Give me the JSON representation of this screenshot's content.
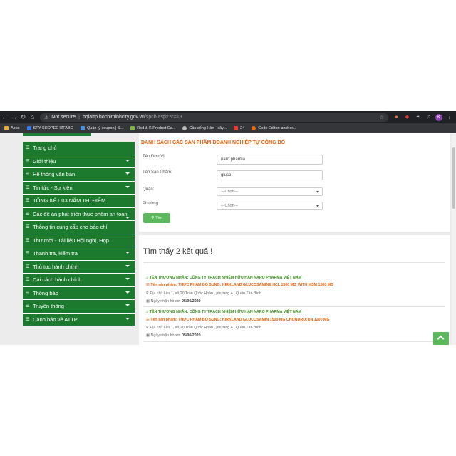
{
  "browser": {
    "security_label": "Not secure",
    "url_host": "bqlattp.hochiminhcity.gov.vn",
    "url_path": "/spcb.aspx?c=19",
    "profile_initial": "K",
    "bookmarks": [
      {
        "label": "Apps",
        "color": "#e0b030"
      },
      {
        "label": "SPY SHOPEE IZFABO",
        "color": "#3b78e7"
      },
      {
        "label": "Quản lý coupon | S...",
        "color": "#4a90d9"
      },
      {
        "label": "Red & K Product Ca...",
        "color": "#7cb342"
      },
      {
        "label": "Cầu sống Hàn - cây...",
        "color": "#bbbbbb"
      },
      {
        "label": "24",
        "color": "#e53935"
      },
      {
        "label": "Code Editor: anchor...",
        "color": "#ef6c00"
      }
    ]
  },
  "sidebar": {
    "items": [
      {
        "label": "Trang chủ",
        "dropdown": false
      },
      {
        "label": "Giới thiệu",
        "dropdown": true
      },
      {
        "label": "Hệ thống văn bản",
        "dropdown": true
      },
      {
        "label": "Tin tức - Sự kiện",
        "dropdown": true
      },
      {
        "label": "TỔNG KẾT 03 NĂM THÍ ĐIỂM",
        "dropdown": false
      },
      {
        "label": "Các đề án phát triển thực phẩm an toàn",
        "dropdown": true
      },
      {
        "label": "Thông tin cung cấp cho báo chí",
        "dropdown": false
      },
      {
        "label": "Thư mời - Tài liệu Hội nghị, Họp",
        "dropdown": false
      },
      {
        "label": "Thanh tra, kiểm tra",
        "dropdown": true
      },
      {
        "label": "Thủ tục hành chính",
        "dropdown": true
      },
      {
        "label": "Cải cách hành chính",
        "dropdown": true
      },
      {
        "label": "Thông báo",
        "dropdown": true
      },
      {
        "label": "Truyền thông",
        "dropdown": true
      },
      {
        "label": "Cảnh báo về ATTP",
        "dropdown": true
      }
    ]
  },
  "form": {
    "title": "DANH SÁCH CÁC SẢN PHẨM DOANH NGHIỆP TỰ CÔNG BỐ",
    "unit_label": "Tên Đơn Vị:",
    "unit_value": "naro pharma",
    "product_label": "Tên Sản Phẩm:",
    "product_value": "gluco",
    "district_label": "Quận:",
    "district_value": "---Chọn---",
    "ward_label": "Phường:",
    "ward_value": "---Chọn---",
    "search_button": "Tìm"
  },
  "results": {
    "summary": "Tìm thấy 2 kết quả !",
    "items": [
      {
        "company": "TÊN THƯƠNG NHÂN: CÔNG TY TRÁCH NHIỆM HỮU HẠN NARO PHARMA VIỆT NAM",
        "product": "Tên sản phẩm: THỰC PHẨM BỔ SUNG: KIRKLAND GLUCOSAMINE HCL 1500 MG WITH MSM 1500 MG",
        "address": "Địa chỉ: Lầu 1, số 20 Trần Quốc Hoàn , phường 4 , Quận Tân Bình",
        "date_label": "Ngày nhận hồ sơ:",
        "date_value": "05/06/2020"
      },
      {
        "company": "TÊN THƯƠNG NHÂN: CÔNG TY TRÁCH NHIỆM HỮU HẠN NARO PHARMA VIỆT NAM",
        "product": "Tên sản phẩm: THỰC PHẨM BỔ SUNG: KIRKLAND GLUCOSAMIN 1500 MG CHONDROITIN 1200 MG",
        "address": "Địa chỉ: Lầu 1, số 20 Trần Quốc Hoàn , phường 4 , Quận Tân Bình",
        "date_label": "Ngày nhận hồ sơ:",
        "date_value": "05/06/2020"
      }
    ]
  }
}
